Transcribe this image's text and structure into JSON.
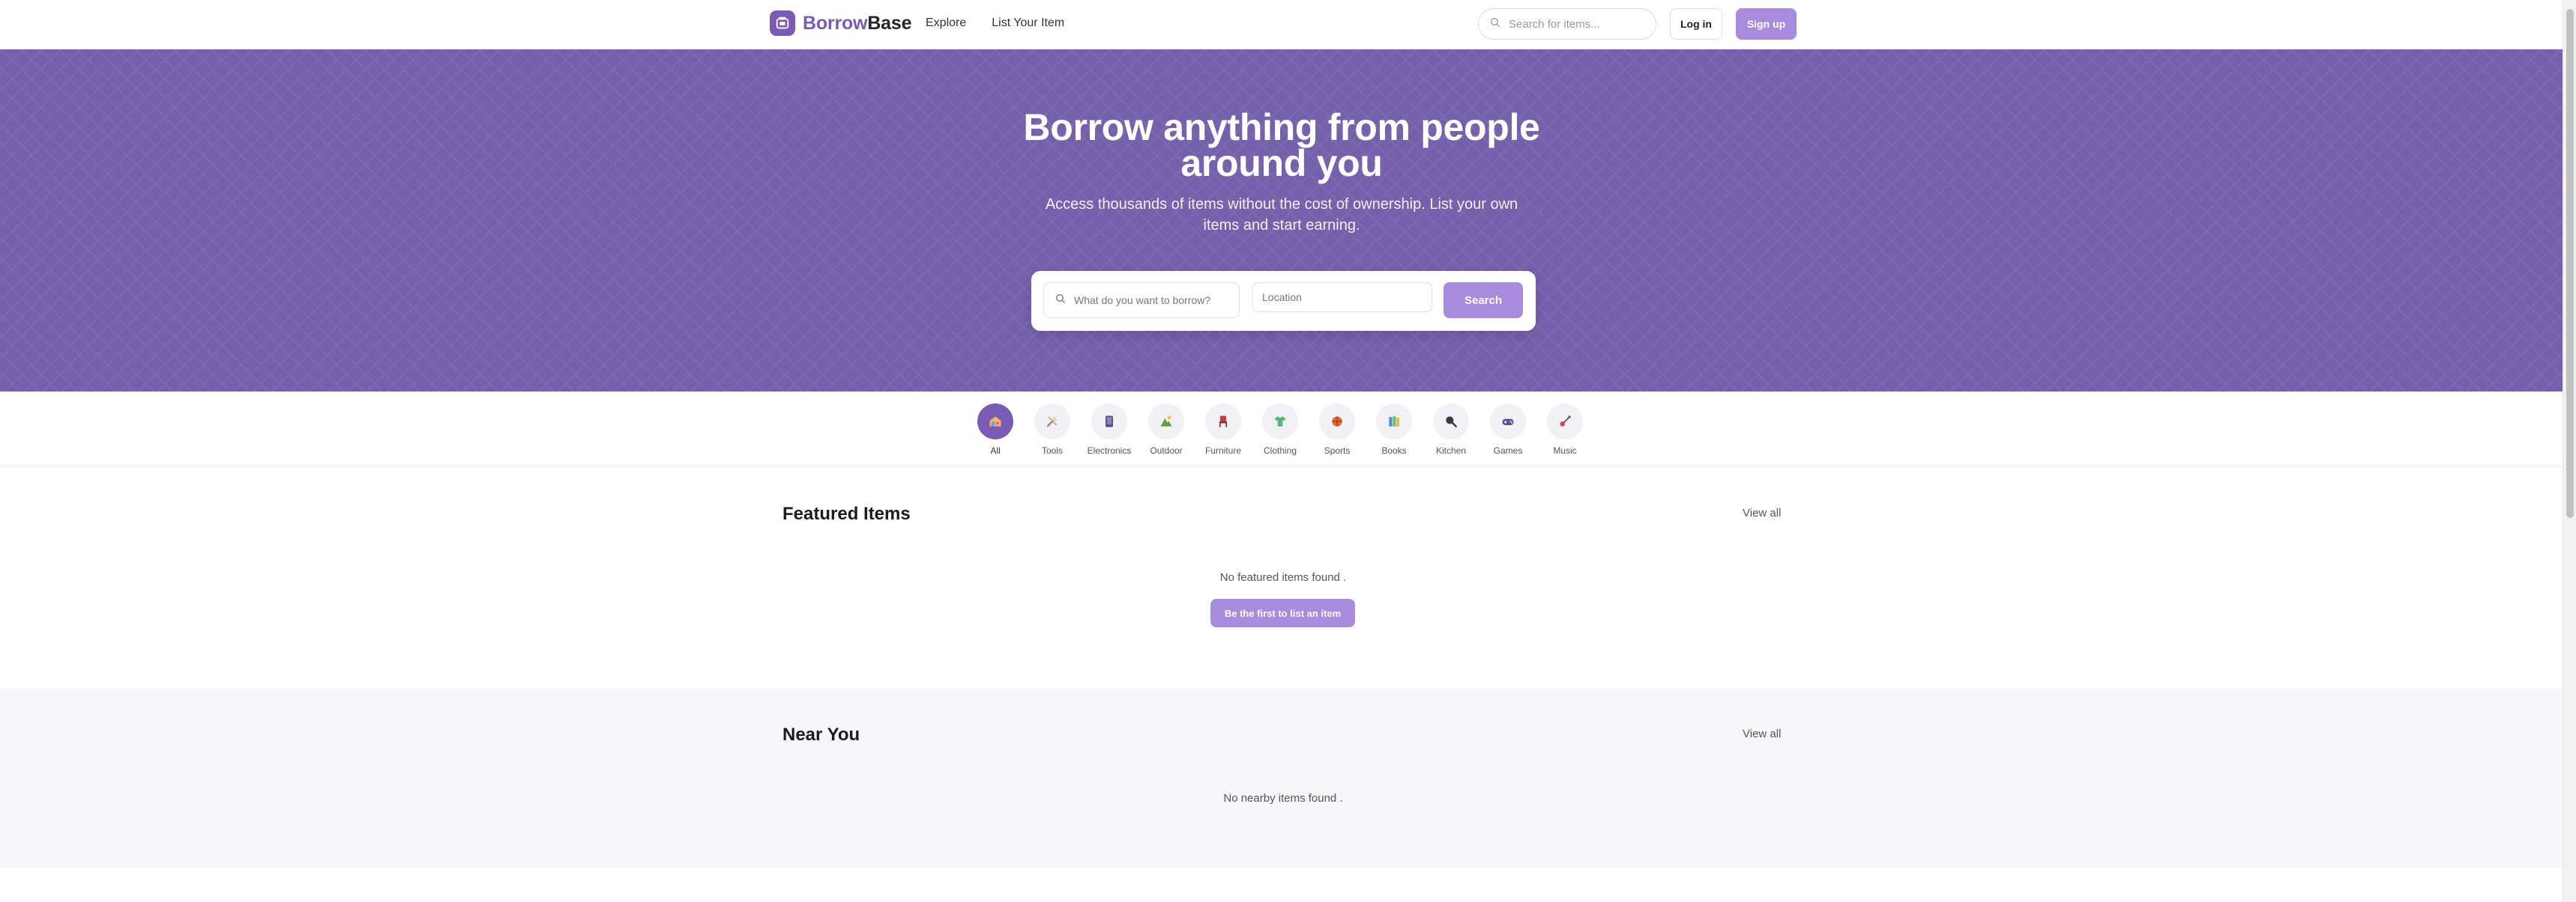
{
  "brand": {
    "name_part1": "Borrow",
    "name_part2": "Base"
  },
  "nav": {
    "explore": "Explore",
    "list_item": "List Your Item"
  },
  "header": {
    "search_placeholder": "Search for items...",
    "login": "Log in",
    "signup": "Sign up"
  },
  "hero": {
    "title": "Borrow anything from people around you",
    "subtitle": "Access thousands of items without the cost of ownership. List your own items and start earning.",
    "search_placeholder": "What do you want to borrow?",
    "location_placeholder": "Location",
    "search_button": "Search"
  },
  "categories": [
    {
      "label": "All",
      "icon": "house-icon",
      "active": true
    },
    {
      "label": "Tools",
      "icon": "tools-icon"
    },
    {
      "label": "Electronics",
      "icon": "electronics-icon"
    },
    {
      "label": "Outdoor",
      "icon": "outdoor-icon"
    },
    {
      "label": "Furniture",
      "icon": "chair-icon"
    },
    {
      "label": "Clothing",
      "icon": "shirt-icon"
    },
    {
      "label": "Sports",
      "icon": "ball-icon"
    },
    {
      "label": "Books",
      "icon": "books-icon"
    },
    {
      "label": "Kitchen",
      "icon": "kitchen-icon"
    },
    {
      "label": "Games",
      "icon": "gamepad-icon"
    },
    {
      "label": "Music",
      "icon": "guitar-icon"
    }
  ],
  "featured": {
    "title": "Featured Items",
    "view_all": "View all",
    "empty_text": "No featured items found .",
    "cta": "Be the first to list an item"
  },
  "near": {
    "title": "Near You",
    "view_all": "View all",
    "empty_text": "No nearby items found ."
  },
  "colors": {
    "brand": "#7a5bb3",
    "hero_bg": "#7560ab",
    "button": "#a78bdc"
  }
}
